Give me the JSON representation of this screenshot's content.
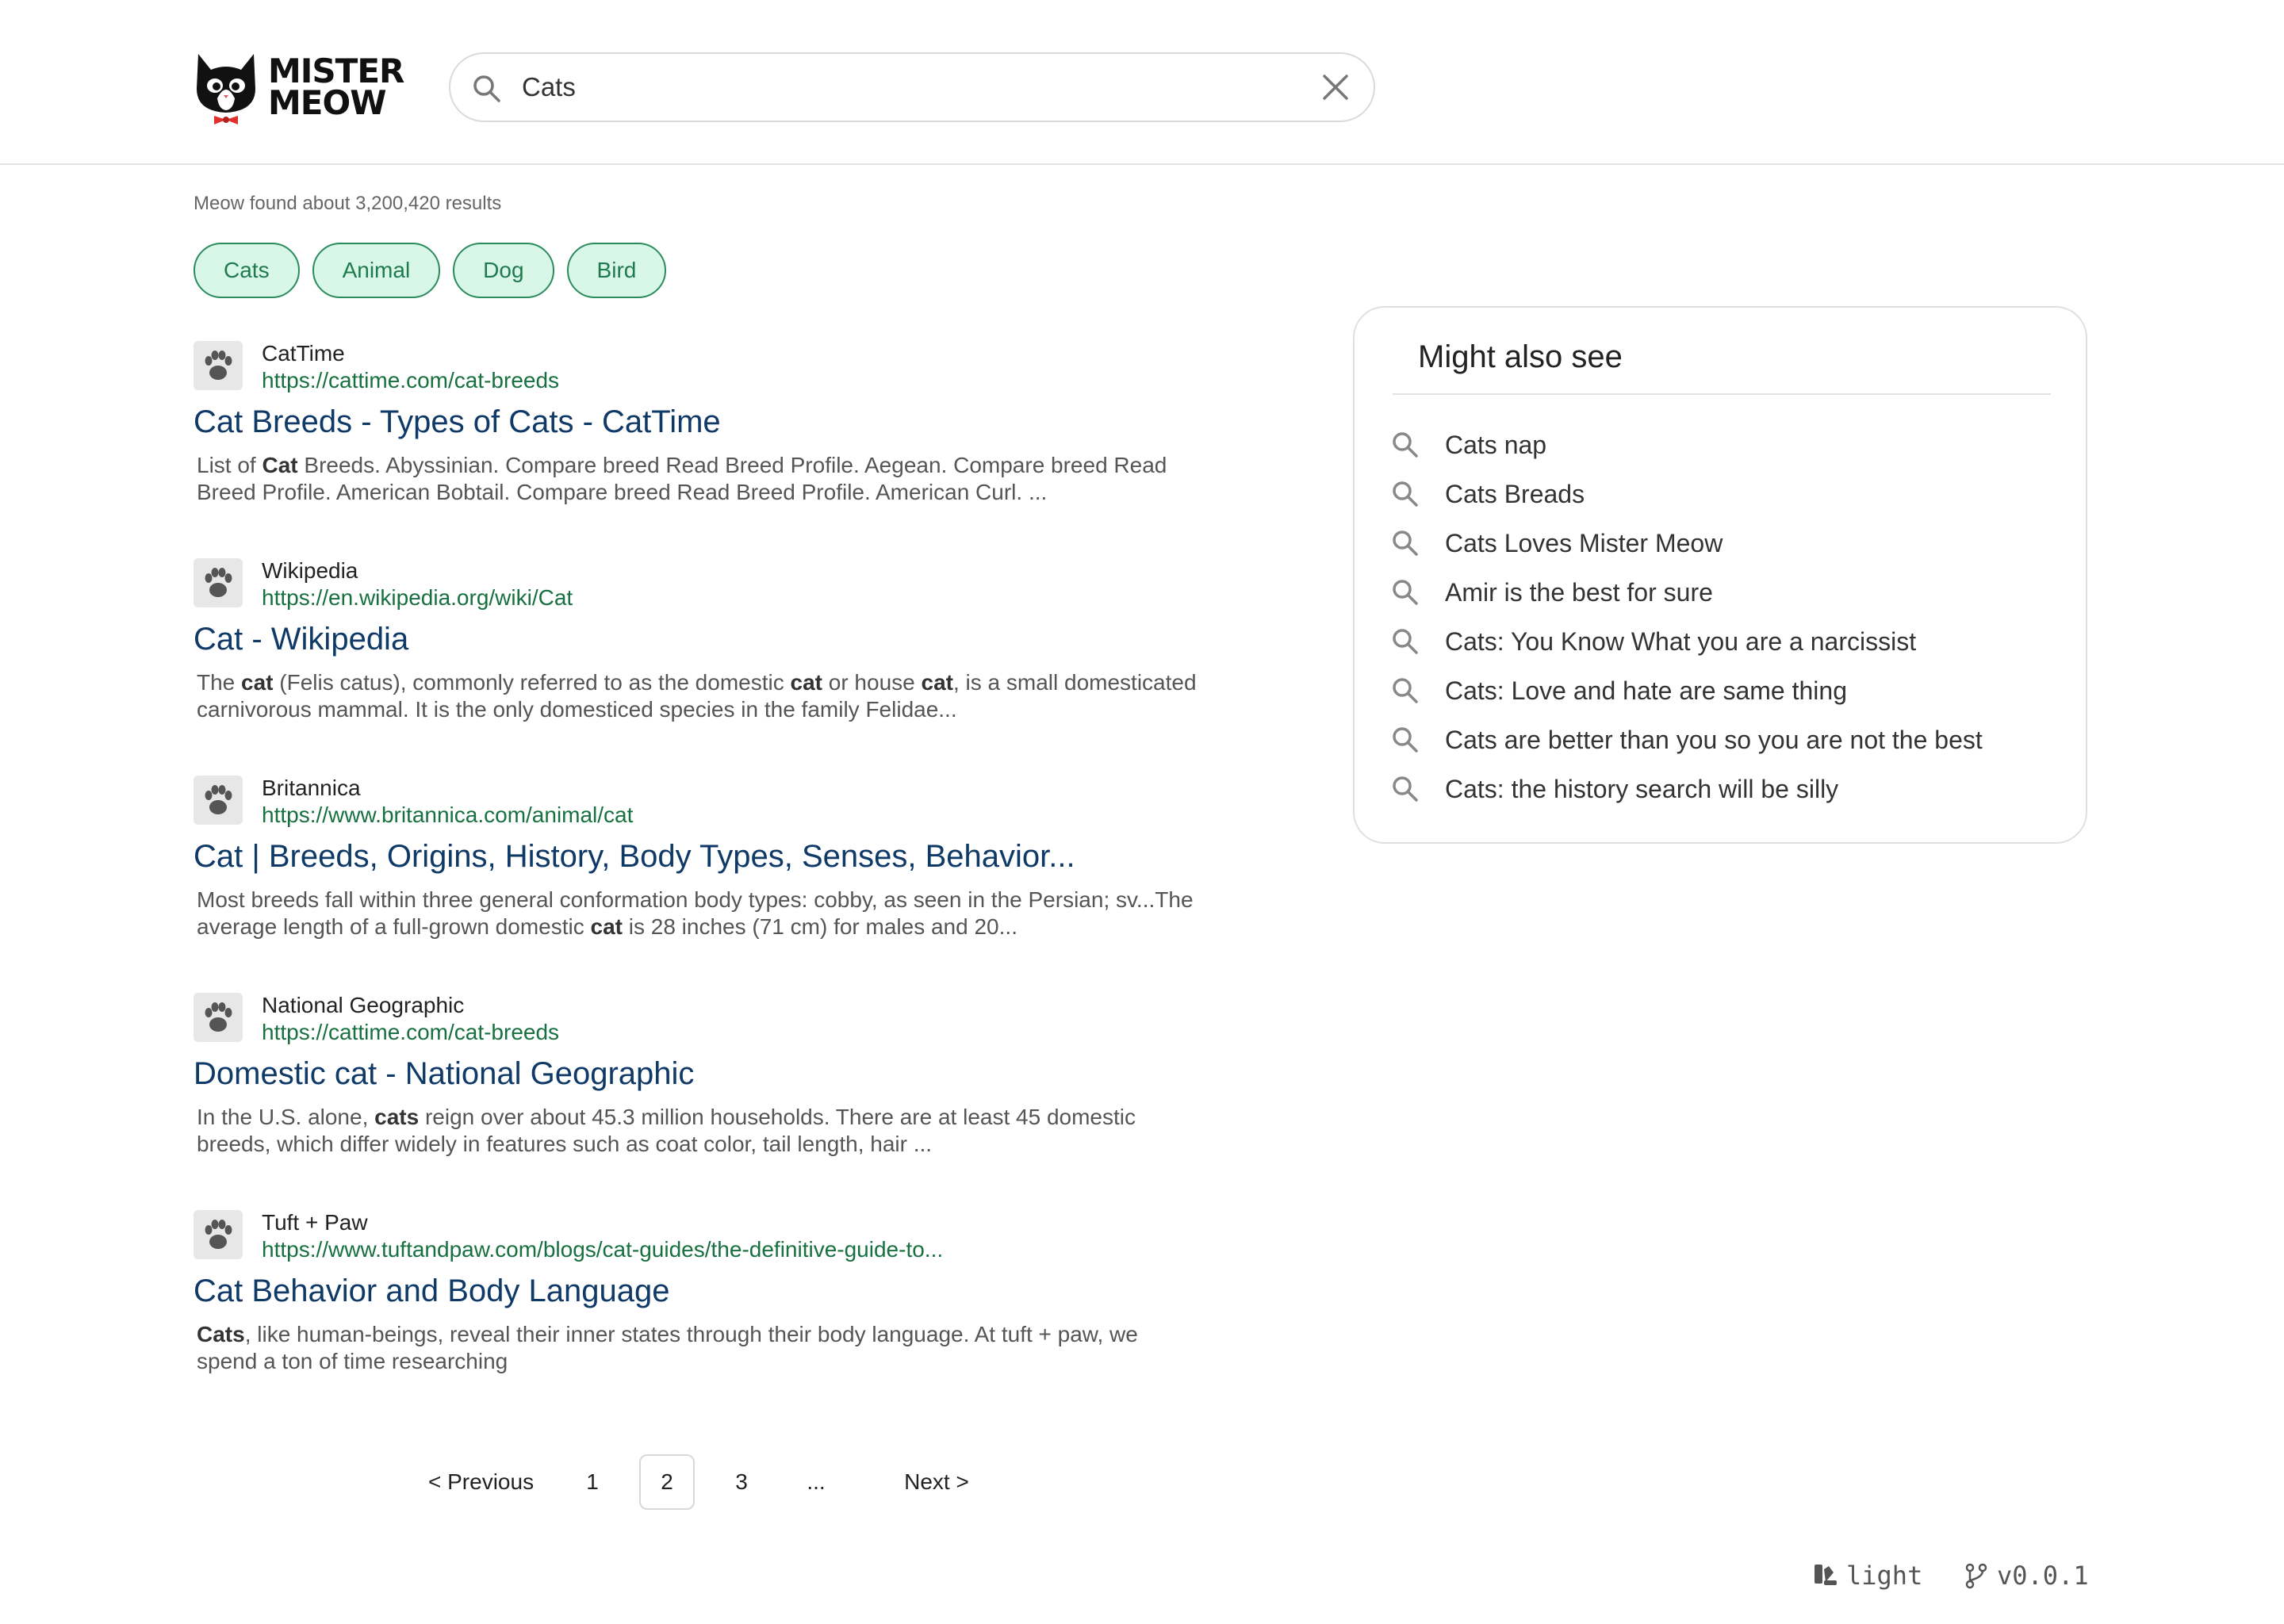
{
  "brand": {
    "line1": "MISTER",
    "line2": "MEOW"
  },
  "search": {
    "value": "Cats"
  },
  "results_count": "Meow found about 3,200,420 results",
  "chips": [
    "Cats",
    "Animal",
    "Dog",
    "Bird"
  ],
  "results": [
    {
      "site": "CatTime",
      "url": "https://cattime.com/cat-breeds",
      "title": "Cat Breeds - Types of Cats - CatTime",
      "snippet": [
        [
          "List of ",
          false
        ],
        [
          "Cat",
          true
        ],
        [
          " Breeds. Abyssinian. Compare breed Read Breed Profile. Aegean. Compare breed Read Breed Profile. American Bobtail. Compare breed Read Breed Profile. American Curl. ...",
          false
        ]
      ]
    },
    {
      "site": "Wikipedia",
      "url": "https://en.wikipedia.org/wiki/Cat",
      "title": "Cat - Wikipedia",
      "snippet": [
        [
          "The ",
          false
        ],
        [
          "cat",
          true
        ],
        [
          " (Felis catus), commonly referred to as the domestic ",
          false
        ],
        [
          "cat",
          true
        ],
        [
          " or house ",
          false
        ],
        [
          "cat",
          true
        ],
        [
          ", is a small domesticated carnivorous mammal. It is the only domesticed species in the family Felidae...",
          false
        ]
      ]
    },
    {
      "site": "Britannica",
      "url": "https://www.britannica.com/animal/cat",
      "title": "Cat | Breeds, Origins, History, Body Types, Senses, Behavior...",
      "snippet": [
        [
          "Most breeds fall within three general conformation body types: cobby, as seen in the Persian; sv...The average length of a full-grown domestic ",
          false
        ],
        [
          "cat",
          true
        ],
        [
          " is 28 inches (71 cm) for males and 20...",
          false
        ]
      ]
    },
    {
      "site": "National Geographic",
      "url": "https://cattime.com/cat-breeds",
      "title": "Domestic cat - National Geographic",
      "snippet": [
        [
          "In the U.S. alone, ",
          false
        ],
        [
          "cats",
          true
        ],
        [
          " reign over about 45.3 million households. There are at least 45 domestic breeds, which differ widely in features such as coat color, tail length, hair ...",
          false
        ]
      ]
    },
    {
      "site": "Tuft + Paw",
      "url": "https://www.tuftandpaw.com/blogs/cat-guides/the-definitive-guide-to...",
      "title": "Cat Behavior and Body Language",
      "snippet": [
        [
          "Cats",
          true
        ],
        [
          ", like human-beings, reveal their inner states through their body language. At tuft + paw, we spend a ton of time researching",
          false
        ]
      ]
    }
  ],
  "pagination": {
    "prev": "< Previous",
    "pages": [
      "1",
      "2",
      "3"
    ],
    "current": "2",
    "ellipsis": "...",
    "next": "Next >"
  },
  "side_panel": {
    "title": "Might also see",
    "suggestions": [
      "Cats nap",
      "Cats Breads",
      "Cats Loves Mister Meow",
      "Amir is the best for sure",
      "Cats: You Know What you are a narcissist",
      "Cats: Love and hate are same thing",
      "Cats are better than you so you are not the best",
      "Cats: the history search will be silly"
    ]
  },
  "footer": {
    "theme": "light",
    "version": "v0.0.1"
  },
  "colors": {
    "chip_bg": "#d8f7e8",
    "chip_border": "#2a8b5c",
    "link_title": "#0f3a68",
    "url_green": "#17703f"
  },
  "icons": {
    "search": "search-icon",
    "clear": "close-icon",
    "favicon": "paw-icon",
    "theme": "theme-icon",
    "version": "git-branch-icon"
  }
}
